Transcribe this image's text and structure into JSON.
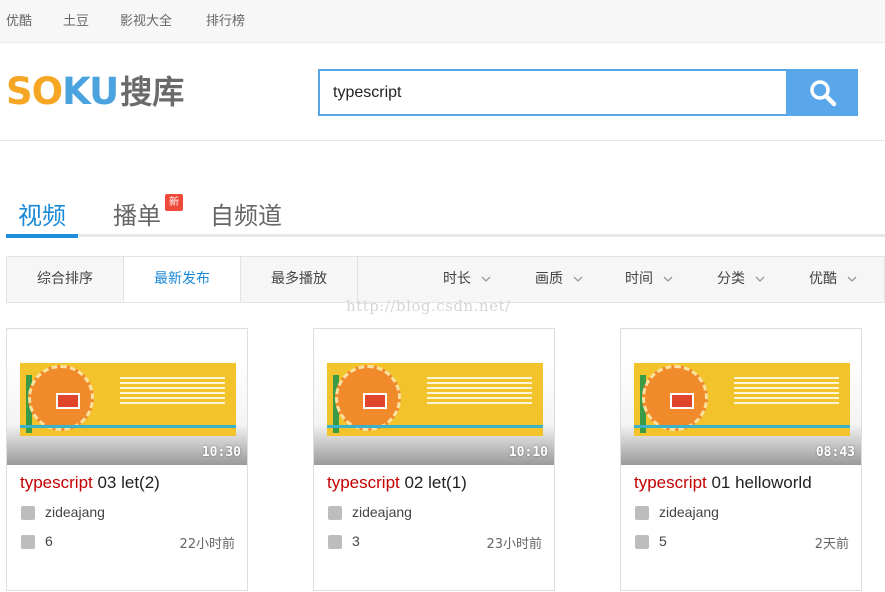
{
  "topnav": [
    "优酷",
    "土豆",
    "影视大全",
    "排行榜"
  ],
  "logo": {
    "text_latin": "SOKU",
    "text_cn": "搜库",
    "colors": {
      "S": "#f5a623",
      "O": "#f5a623",
      "K": "#4aa3df",
      "U": "#4aa3df"
    }
  },
  "search": {
    "value": "typescript",
    "button_icon": "search-icon"
  },
  "tabs": [
    {
      "label": "视频",
      "active": true
    },
    {
      "label": "播单",
      "badge": "新"
    },
    {
      "label": "自频道"
    }
  ],
  "sort_options": [
    {
      "label": "综合排序"
    },
    {
      "label": "最新发布",
      "active": true
    },
    {
      "label": "最多播放"
    }
  ],
  "filters": [
    "时长",
    "画质",
    "时间",
    "分类",
    "优酷"
  ],
  "watermark": "http://blog.csdn.net/",
  "accent": "#1a8ad8",
  "videos": [
    {
      "keyword": "typescript",
      "title_rest": " 03 let(2)",
      "duration": "10:30",
      "author": "zideajang",
      "plays": "6",
      "time": "22小时前"
    },
    {
      "keyword": "typescript",
      "title_rest": " 02 let(1)",
      "duration": "10:10",
      "author": "zideajang",
      "plays": "3",
      "time": "23小时前"
    },
    {
      "keyword": "typescript",
      "title_rest": " 01 helloworld",
      "duration": "08:43",
      "author": "zideajang",
      "plays": "5",
      "time": "2天前"
    }
  ]
}
